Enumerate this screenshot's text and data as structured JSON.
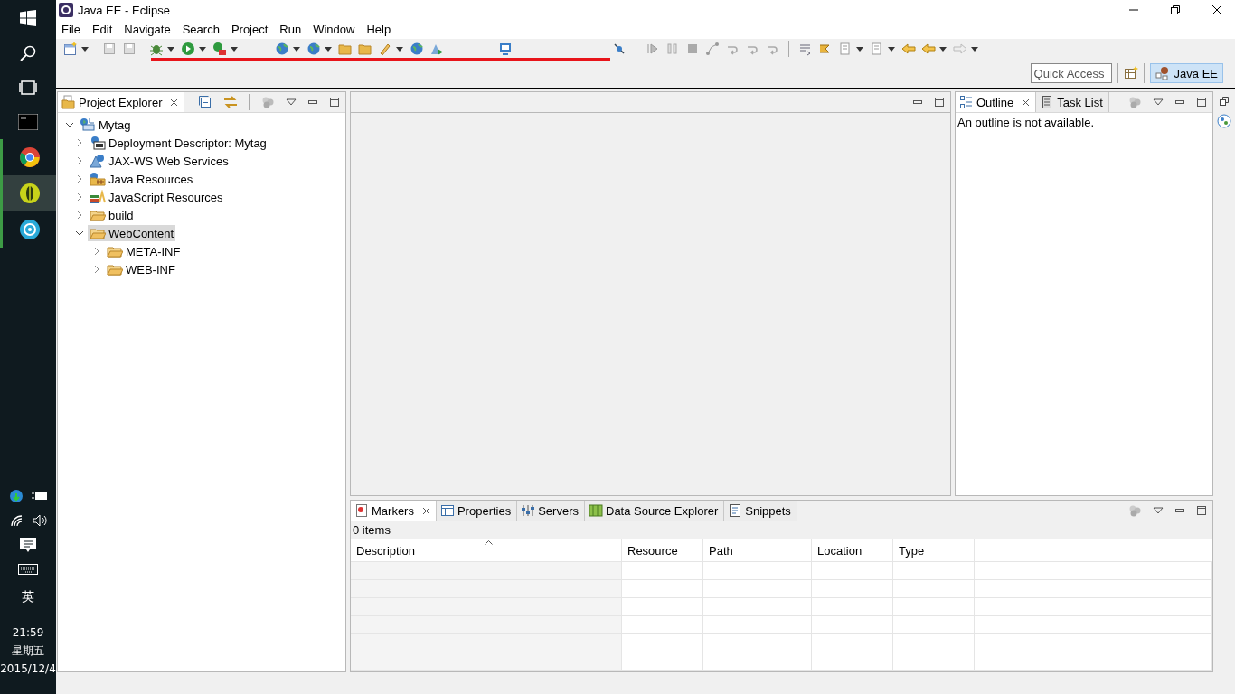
{
  "window": {
    "title": "Java EE - Eclipse"
  },
  "menu": [
    "File",
    "Edit",
    "Navigate",
    "Search",
    "Project",
    "Run",
    "Window",
    "Help"
  ],
  "quick_access": {
    "placeholder": "Quick Access"
  },
  "perspective": {
    "label": "Java EE",
    "selected": true
  },
  "project_explorer": {
    "tab": {
      "label": "Project Explorer",
      "selected": true
    },
    "tree": [
      {
        "label": "Mytag",
        "kind": "project",
        "expanded": true,
        "selected": false,
        "children": [
          {
            "label": "Deployment Descriptor: Mytag",
            "kind": "descriptor",
            "expanded": false,
            "selected": false
          },
          {
            "label": "JAX-WS Web Services",
            "kind": "webservice",
            "expanded": false,
            "selected": false
          },
          {
            "label": "Java Resources",
            "kind": "javares",
            "expanded": false,
            "selected": false
          },
          {
            "label": "JavaScript Resources",
            "kind": "jsres",
            "expanded": false,
            "selected": false
          },
          {
            "label": "build",
            "kind": "folder",
            "expanded": false,
            "selected": false
          },
          {
            "label": "WebContent",
            "kind": "folder",
            "expanded": true,
            "selected": true,
            "children": [
              {
                "label": "META-INF",
                "kind": "folder",
                "expanded": false,
                "selected": false
              },
              {
                "label": "WEB-INF",
                "kind": "folder",
                "expanded": false,
                "selected": false
              }
            ]
          }
        ]
      }
    ]
  },
  "outline": {
    "tabs": [
      {
        "label": "Outline",
        "selected": true
      },
      {
        "label": "Task List",
        "selected": false
      }
    ],
    "message": "An outline is not available."
  },
  "bottom_panel": {
    "tabs": [
      {
        "label": "Markers",
        "selected": true
      },
      {
        "label": "Properties",
        "selected": false
      },
      {
        "label": "Servers",
        "selected": false
      },
      {
        "label": "Data Source Explorer",
        "selected": false
      },
      {
        "label": "Snippets",
        "selected": false
      }
    ],
    "status": "0 items",
    "columns": [
      "Description",
      "Resource",
      "Path",
      "Location",
      "Type"
    ]
  },
  "taskbar": {
    "ime": "英",
    "time": "21:59",
    "weekday": "星期五",
    "date": "2015/12/4"
  }
}
